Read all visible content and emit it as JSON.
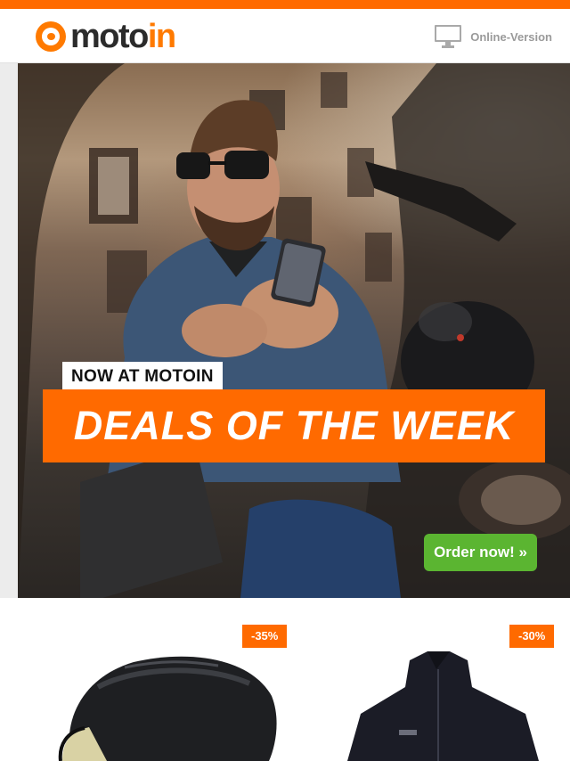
{
  "header": {
    "brand_part1": "moto",
    "brand_part2": "in",
    "online_version_label": "Online-Version",
    "icons": {
      "logo": "motoin-logo-icon",
      "monitor": "monitor-icon"
    }
  },
  "hero": {
    "kicker": "NOW AT MOTOIN",
    "headline": "DEALS OF THE WEEK",
    "cta_label": "Order now! »"
  },
  "products": [
    {
      "name_icon": "helmet-image",
      "discount": "-35%"
    },
    {
      "name_icon": "jacket-image",
      "discount": "-30%"
    }
  ],
  "colors": {
    "accent": "#ff6a00",
    "cta": "#5bb531",
    "logo_dark": "#2b2b2b",
    "muted_text": "#9a9a9a"
  }
}
